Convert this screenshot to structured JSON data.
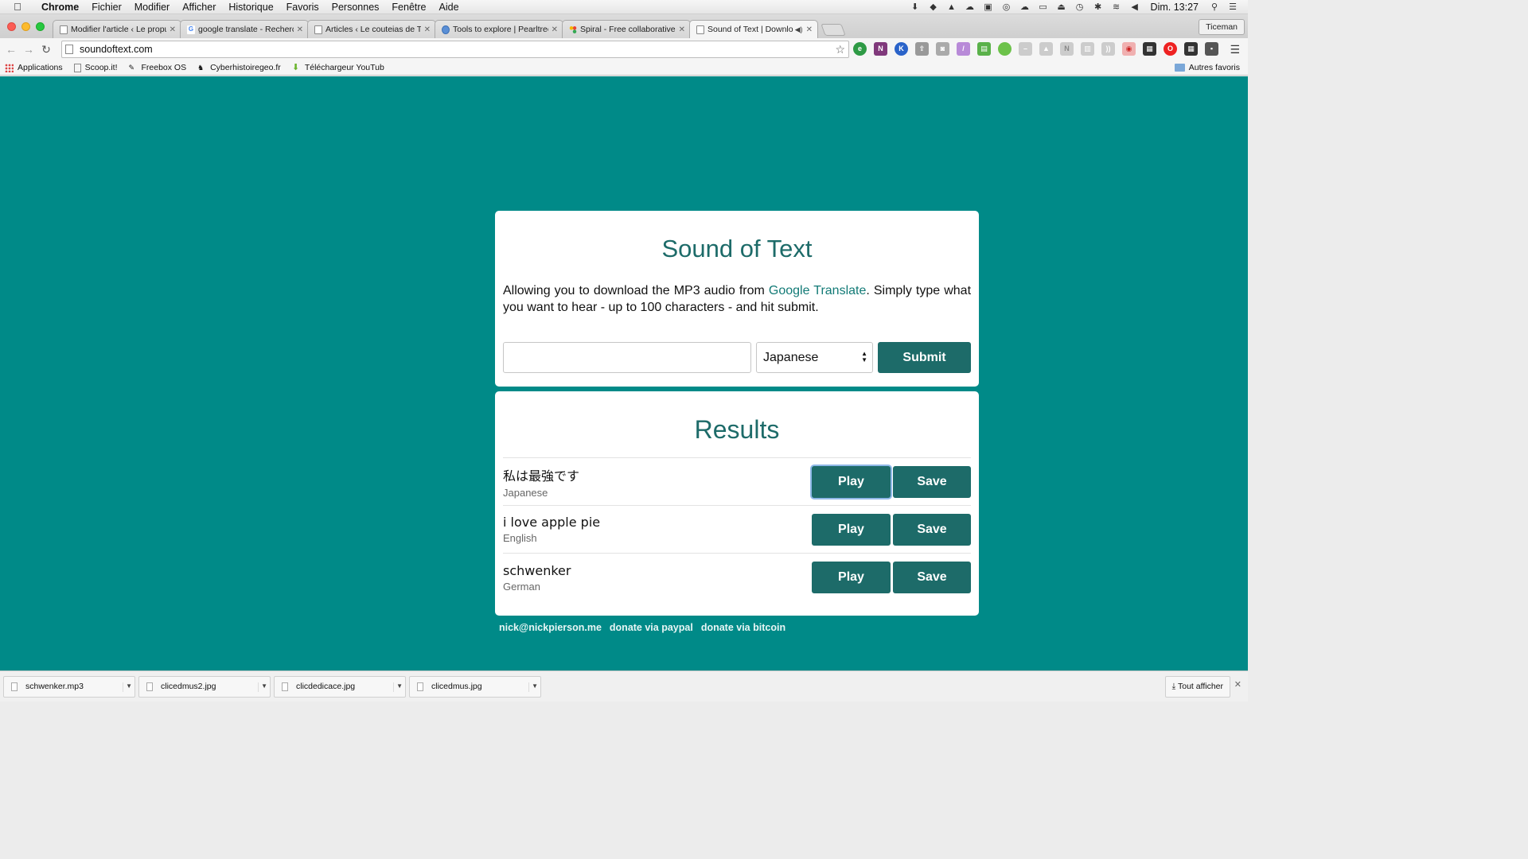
{
  "menubar": {
    "app": "Chrome",
    "items": [
      "Fichier",
      "Modifier",
      "Afficher",
      "Historique",
      "Favoris",
      "Personnes",
      "Fenêtre",
      "Aide"
    ],
    "clock": "Dim. 13:27"
  },
  "tabs": [
    {
      "title": "Modifier l'article ‹ Le propu",
      "favicon": "page-icon"
    },
    {
      "title": "google translate - Recherc",
      "favicon": "google-icon"
    },
    {
      "title": "Articles ‹ Le couteias de T",
      "favicon": "page-icon"
    },
    {
      "title": "Tools to explore | Pearltree",
      "favicon": "pearltrees-icon"
    },
    {
      "title": "Spiral - Free collaborative",
      "favicon": "spiral-icon"
    },
    {
      "title": "Sound of Text | Downlo",
      "favicon": "page-icon",
      "active": true
    }
  ],
  "profile": "Ticeman",
  "address": "soundoftext.com",
  "bookmarks": {
    "items": [
      "Applications",
      "Scoop.it!",
      "Freebox OS",
      "Cyberhistoiregeo.fr",
      "Téléchargeur YouTub"
    ],
    "other": "Autres favoris"
  },
  "page": {
    "title": "Sound of Text",
    "desc_before": "Allowing you to download the MP3 audio from ",
    "desc_link": "Google Translate",
    "desc_after": ". Simply type what you want to hear - up to 100 characters - and hit submit.",
    "input_value": "",
    "selected_language": "Japanese",
    "submit_label": "Submit",
    "results_title": "Results",
    "results": [
      {
        "text": "私は最強です",
        "language": "Japanese"
      },
      {
        "text": "i love apple pie",
        "language": "English"
      },
      {
        "text": "schwenker",
        "language": "German"
      }
    ],
    "play_label": "Play",
    "save_label": "Save",
    "footer": [
      "nick@nickpierson.me",
      "donate via paypal",
      "donate via bitcoin"
    ]
  },
  "downloads": {
    "items": [
      "schwenker.mp3",
      "clicedmus2.jpg",
      "clicdedicace.jpg",
      "clicedmus.jpg"
    ],
    "show_all": "Tout afficher"
  },
  "colors": {
    "page_bg": "#008a88",
    "accent": "#1d6b69"
  }
}
